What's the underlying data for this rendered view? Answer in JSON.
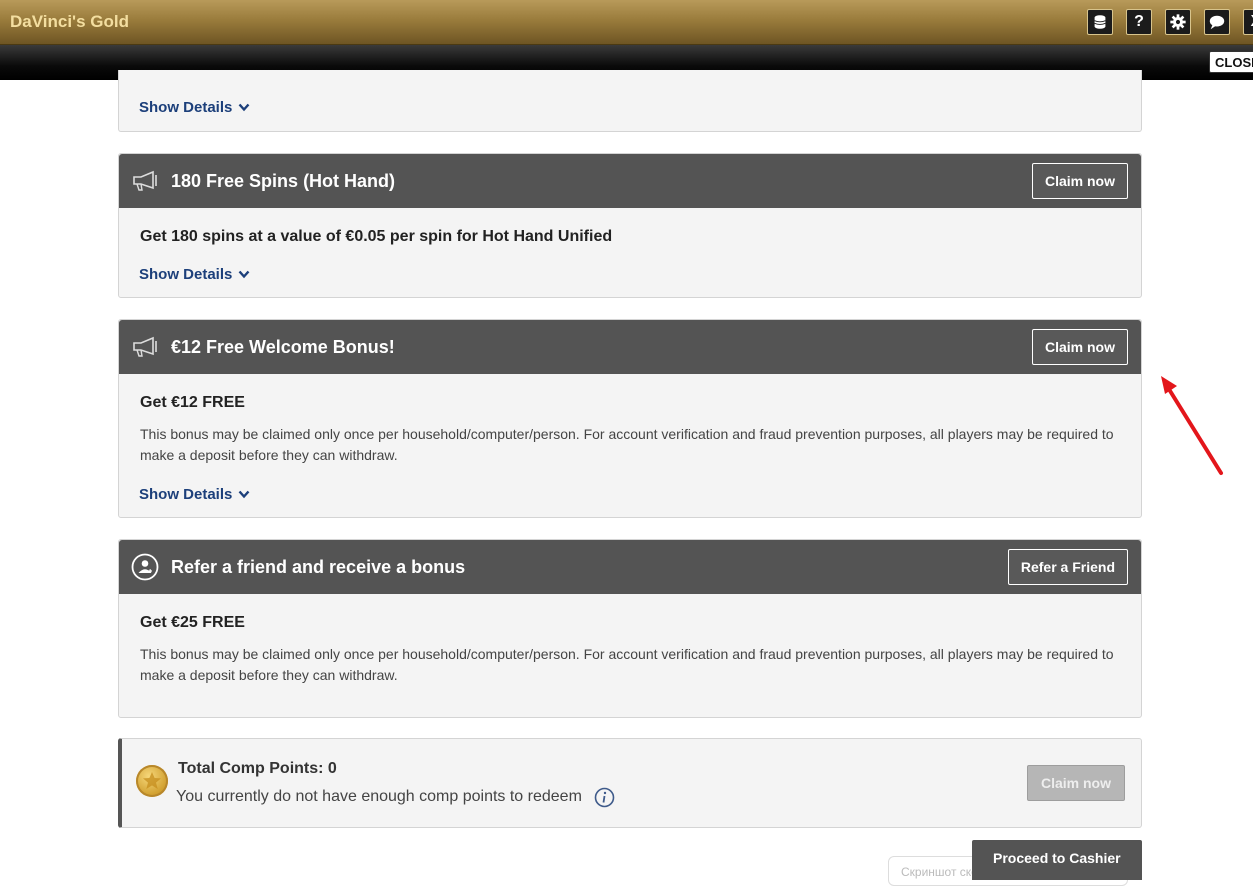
{
  "app": {
    "title": "DaVinci's Gold",
    "close_label": "CLOSE",
    "help_label": "?",
    "x_label": "X"
  },
  "promos": [
    {
      "title": "",
      "lead": "",
      "description": "",
      "details_label": "Show Details"
    },
    {
      "title": "180 Free Spins (Hot Hand)",
      "button": "Claim now",
      "lead": "Get 180 spins at a value of €0.05 per spin for Hot Hand Unified",
      "details_label": "Show Details"
    },
    {
      "title": "€12 Free Welcome Bonus!",
      "button": "Claim now",
      "lead": "Get €12 FREE",
      "description": "This bonus may be claimed only once per household/computer/person. For account verification and fraud prevention purposes, all players may be required to make a deposit before they can withdraw.",
      "details_label": "Show Details"
    },
    {
      "title": "Refer a friend and receive a bonus",
      "button": "Refer a Friend",
      "lead": "Get €25 FREE",
      "description": "This bonus may be claimed only once per household/computer/person. For account verification and fraud prevention purposes, all players may be required to make a deposit before they can withdraw."
    }
  ],
  "comp": {
    "title": "Total Comp Points: 0",
    "subtitle": "You currently do not have enough comp points to redeem",
    "button": "Claim now"
  },
  "footer": {
    "cashier_label": "Proceed to Cashier",
    "toast": "Скриншот скопирован в буфер обмена"
  },
  "colors": {
    "accent_gold": "#9a7c3c",
    "header_gray": "#545454",
    "link_blue": "#1c3f7a",
    "annotation_red": "#e3161b"
  }
}
